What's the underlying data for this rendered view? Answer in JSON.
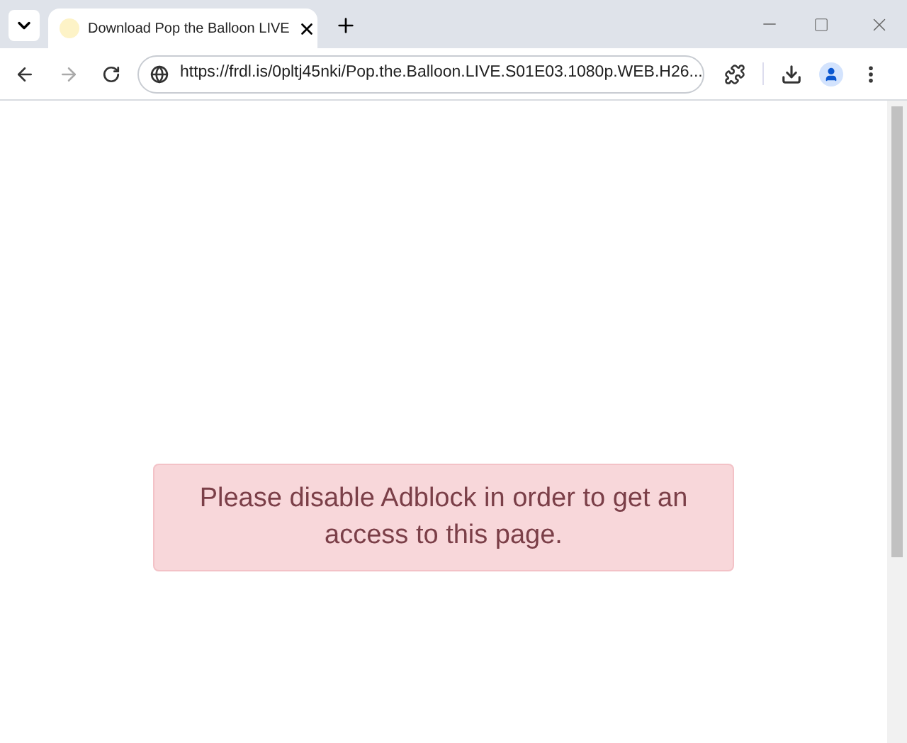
{
  "tabs": [
    {
      "title": "Download Pop the Balloon LIVE",
      "selected": true
    }
  ],
  "address_bar": {
    "url": "https://frdl.is/0pltj45nki/Pop.the.Balloon.LIVE.S01E03.1080p.WEB.H26..."
  },
  "alert": {
    "message": "Please disable Adblock in order to get an access to this page."
  }
}
